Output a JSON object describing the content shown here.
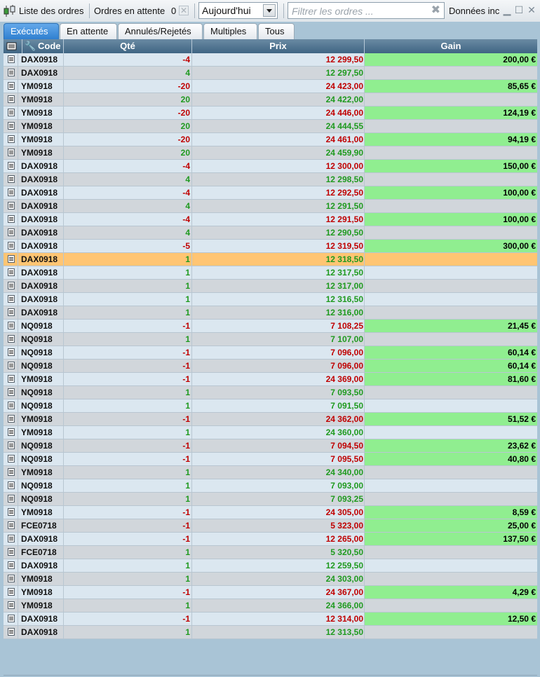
{
  "toolbar": {
    "title": "Liste des ordres",
    "pending_label": "Ordres en attente",
    "pending_count": "0",
    "date_filter": "Aujourd'hui",
    "search_placeholder": "Filtrer les ordres ...",
    "data_label": "Données inc"
  },
  "tabs": [
    "Exécutés",
    "En attente",
    "Annulés/Rejetés",
    "Multiples",
    "Tous"
  ],
  "columns": {
    "code": "Code",
    "qty": "Qté",
    "price": "Prix",
    "gain": "Gain"
  },
  "rows": [
    {
      "code": "DAX0918",
      "qty": "-4",
      "price": "12 299,50",
      "gain": "200,00 €"
    },
    {
      "code": "DAX0918",
      "qty": "4",
      "price": "12 297,50",
      "gain": ""
    },
    {
      "code": "YM0918",
      "qty": "-20",
      "price": "24 423,00",
      "gain": "85,65 €"
    },
    {
      "code": "YM0918",
      "qty": "20",
      "price": "24 422,00",
      "gain": ""
    },
    {
      "code": "YM0918",
      "qty": "-20",
      "price": "24 446,00",
      "gain": "124,19 €"
    },
    {
      "code": "YM0918",
      "qty": "20",
      "price": "24 444,55",
      "gain": ""
    },
    {
      "code": "YM0918",
      "qty": "-20",
      "price": "24 461,00",
      "gain": "94,19 €"
    },
    {
      "code": "YM0918",
      "qty": "20",
      "price": "24 459,90",
      "gain": ""
    },
    {
      "code": "DAX0918",
      "qty": "-4",
      "price": "12 300,00",
      "gain": "150,00 €"
    },
    {
      "code": "DAX0918",
      "qty": "4",
      "price": "12 298,50",
      "gain": ""
    },
    {
      "code": "DAX0918",
      "qty": "-4",
      "price": "12 292,50",
      "gain": "100,00 €"
    },
    {
      "code": "DAX0918",
      "qty": "4",
      "price": "12 291,50",
      "gain": ""
    },
    {
      "code": "DAX0918",
      "qty": "-4",
      "price": "12 291,50",
      "gain": "100,00 €"
    },
    {
      "code": "DAX0918",
      "qty": "4",
      "price": "12 290,50",
      "gain": ""
    },
    {
      "code": "DAX0918",
      "qty": "-5",
      "price": "12 319,50",
      "gain": "300,00 €"
    },
    {
      "code": "DAX0918",
      "qty": "1",
      "price": "12 318,50",
      "gain": "",
      "selected": true
    },
    {
      "code": "DAX0918",
      "qty": "1",
      "price": "12 317,50",
      "gain": ""
    },
    {
      "code": "DAX0918",
      "qty": "1",
      "price": "12 317,00",
      "gain": ""
    },
    {
      "code": "DAX0918",
      "qty": "1",
      "price": "12 316,50",
      "gain": ""
    },
    {
      "code": "DAX0918",
      "qty": "1",
      "price": "12 316,00",
      "gain": ""
    },
    {
      "code": "NQ0918",
      "qty": "-1",
      "price": "7 108,25",
      "gain": "21,45 €"
    },
    {
      "code": "NQ0918",
      "qty": "1",
      "price": "7 107,00",
      "gain": ""
    },
    {
      "code": "NQ0918",
      "qty": "-1",
      "price": "7 096,00",
      "gain": "60,14 €"
    },
    {
      "code": "NQ0918",
      "qty": "-1",
      "price": "7 096,00",
      "gain": "60,14 €"
    },
    {
      "code": "YM0918",
      "qty": "-1",
      "price": "24 369,00",
      "gain": "81,60 €"
    },
    {
      "code": "NQ0918",
      "qty": "1",
      "price": "7 093,50",
      "gain": ""
    },
    {
      "code": "NQ0918",
      "qty": "1",
      "price": "7 091,50",
      "gain": ""
    },
    {
      "code": "YM0918",
      "qty": "-1",
      "price": "24 362,00",
      "gain": "51,52 €"
    },
    {
      "code": "YM0918",
      "qty": "1",
      "price": "24 360,00",
      "gain": ""
    },
    {
      "code": "NQ0918",
      "qty": "-1",
      "price": "7 094,50",
      "gain": "23,62 €"
    },
    {
      "code": "NQ0918",
      "qty": "-1",
      "price": "7 095,50",
      "gain": "40,80 €"
    },
    {
      "code": "YM0918",
      "qty": "1",
      "price": "24 340,00",
      "gain": ""
    },
    {
      "code": "NQ0918",
      "qty": "1",
      "price": "7 093,00",
      "gain": ""
    },
    {
      "code": "NQ0918",
      "qty": "1",
      "price": "7 093,25",
      "gain": ""
    },
    {
      "code": "YM0918",
      "qty": "-1",
      "price": "24 305,00",
      "gain": "8,59 €"
    },
    {
      "code": "FCE0718",
      "qty": "-1",
      "price": "5 323,00",
      "gain": "25,00 €"
    },
    {
      "code": "DAX0918",
      "qty": "-1",
      "price": "12 265,00",
      "gain": "137,50 €"
    },
    {
      "code": "FCE0718",
      "qty": "1",
      "price": "5 320,50",
      "gain": ""
    },
    {
      "code": "DAX0918",
      "qty": "1",
      "price": "12 259,50",
      "gain": ""
    },
    {
      "code": "YM0918",
      "qty": "1",
      "price": "24 303,00",
      "gain": ""
    },
    {
      "code": "YM0918",
      "qty": "-1",
      "price": "24 367,00",
      "gain": "4,29 €"
    },
    {
      "code": "YM0918",
      "qty": "1",
      "price": "24 366,00",
      "gain": ""
    },
    {
      "code": "DAX0918",
      "qty": "-1",
      "price": "12 314,00",
      "gain": "12,50 €"
    },
    {
      "code": "DAX0918",
      "qty": "1",
      "price": "12 313,50",
      "gain": ""
    }
  ],
  "colors": {
    "negative": "#c00000",
    "positive": "#1f9a1f",
    "gain_bg": "#90ee90",
    "selected_bg": "#ffc573",
    "tab_active": "#2f7fd0"
  }
}
